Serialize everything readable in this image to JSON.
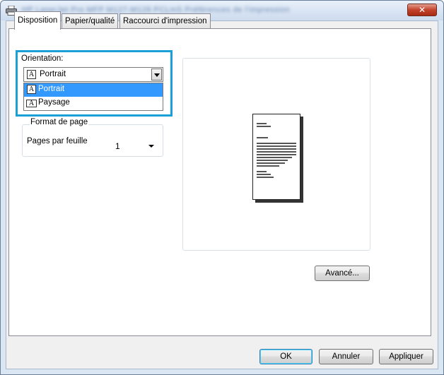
{
  "window": {
    "title": "HP LaserJet Pro MFP M127-M128 PCLmS Préférences de l'impression",
    "close_label": "✕"
  },
  "tabs": [
    {
      "label": "Disposition",
      "active": true
    },
    {
      "label": "Papier/qualité",
      "active": false
    },
    {
      "label": "Raccourci d'impression",
      "active": false
    }
  ],
  "orientation": {
    "label": "Orientation:",
    "selected": "Portrait",
    "options": [
      "Portrait",
      "Paysage"
    ],
    "highlighted_option": "Portrait",
    "glyph": "A"
  },
  "format": {
    "group_label": "Format de page",
    "pages_label": "Pages par feuille",
    "pages_value": "1"
  },
  "buttons": {
    "advanced": "Avancé...",
    "ok": "OK",
    "cancel": "Annuler",
    "apply": "Appliquer"
  },
  "colors": {
    "highlight_border": "#1aa0d6",
    "selection": "#3399ff"
  }
}
